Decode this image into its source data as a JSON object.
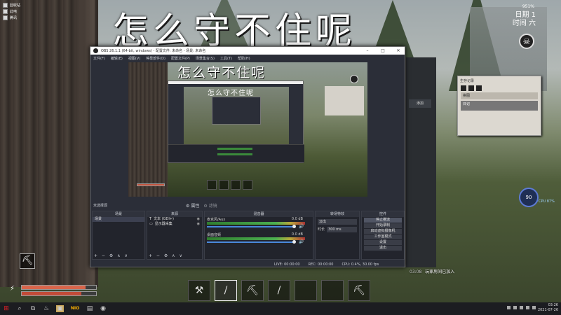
{
  "desktop": {
    "icons": [
      "回收站",
      "此电",
      "腾讯"
    ]
  },
  "overlay_title": "怎么守不住呢",
  "hud": {
    "top_small": "951%",
    "day_label": "日期 1",
    "time_label": "时间 六",
    "skull_glyph": "☠"
  },
  "survival_log": {
    "title": "生存记录",
    "row1": "拼图",
    "row2": "日记"
  },
  "rec_panel": {
    "button": "添加"
  },
  "rec_badge": {
    "value": "90",
    "sub": "CPU 87%"
  },
  "join_message": {
    "time": "03:08",
    "text": "玩家房间已加入"
  },
  "obs": {
    "title": "OBS 26.1.1 (64-bit, windows) - 配置文件: 未命名 - 场景: 未命名",
    "window_controls": [
      "–",
      "□",
      "✕"
    ],
    "menu": [
      "文件(F)",
      "编辑(E)",
      "视图(V)",
      "停靠部件(D)",
      "配置文件(P)",
      "场景集合(S)",
      "工具(T)",
      "帮助(H)"
    ],
    "preview": {
      "title": "怎么守不住呢",
      "nested_title": "怎么守不住呢"
    },
    "source_strip": {
      "label": "未选择源",
      "prop": "属性",
      "filter": "滤镜"
    },
    "scenes": {
      "header": "场景",
      "items": [
        "场景"
      ]
    },
    "sources": {
      "header": "来源",
      "items": [
        {
          "icon": "T",
          "label": "文本 (GDI+)"
        },
        {
          "icon": "▭",
          "label": "显示器采集"
        }
      ]
    },
    "mixer": {
      "header": "混音器",
      "tracks": [
        {
          "name": "麦克风/Aux",
          "db": "0.0 dB"
        },
        {
          "name": "桌面音频",
          "db": "0.0 dB"
        }
      ]
    },
    "transitions": {
      "header": "转场特效",
      "type": "淡出",
      "duration_label": "时长",
      "duration": "300 ms"
    },
    "controls": {
      "header": "控件",
      "buttons": [
        "停止推流",
        "开始录制",
        "启动虚拟摄像机",
        "工作室模式",
        "设置",
        "退出"
      ]
    },
    "footer_buttons": "+ − ⚙ ∧ ∨",
    "status": [
      "LIVE: 00:00:00",
      "REC: 00:00:00",
      "CPU: 0.4%, 30.00 fps"
    ]
  },
  "hotbar": {
    "tool_slot_glyph": "⛏",
    "slots": [
      "⚒",
      "/",
      "⛏",
      "/",
      "",
      "",
      "⛏"
    ]
  },
  "taskbar": {
    "start": "⊞",
    "apps": [
      "⌕",
      "⧉",
      "♨",
      "▣",
      "NIO",
      "▤",
      "◉"
    ],
    "time": "03:26",
    "date": "2021-07-26"
  },
  "colors": {
    "accent_blue": "#4a89dc",
    "health": "#d9654b",
    "obs_bg": "#2b2e38"
  },
  "health": {
    "level": 0.86,
    "stamina": 0.8
  }
}
